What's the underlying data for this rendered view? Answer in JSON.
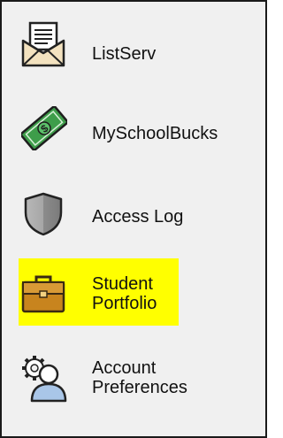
{
  "menu": {
    "items": [
      {
        "id": "listserv",
        "lines": [
          "ListServ"
        ],
        "icon": "envelope-letter-icon"
      },
      {
        "id": "myschoolbucks",
        "lines": [
          "MySchoolBucks"
        ],
        "icon": "money-bill-icon"
      },
      {
        "id": "access-log",
        "lines": [
          "Access Log"
        ],
        "icon": "shield-icon"
      },
      {
        "id": "student-portfolio",
        "lines": [
          "Student",
          "Portfolio"
        ],
        "icon": "briefcase-icon",
        "highlighted": true
      },
      {
        "id": "account-preferences",
        "lines": [
          "Account",
          "Preferences"
        ],
        "icon": "user-gear-icon"
      }
    ]
  },
  "colors": {
    "highlight": "#ffff00",
    "background": "#f0f0f0",
    "border": "#1a1a1a",
    "money_green": "#2e8b3a",
    "briefcase_orange": "#c8841e"
  }
}
